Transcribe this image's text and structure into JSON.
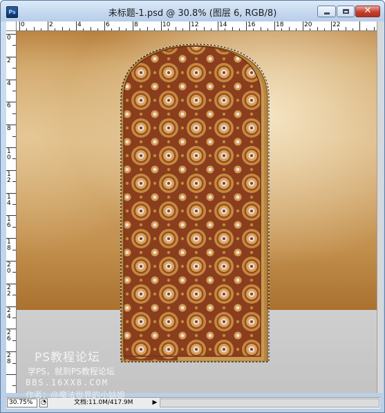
{
  "window": {
    "title": "未标题-1.psd @ 30.8% (图层 6, RGB/8)",
    "app_icon_label": "Ps",
    "close_glyph": "✕"
  },
  "ruler_h_labels": [
    "0",
    "2",
    "4",
    "6",
    "8",
    "10",
    "12",
    "14",
    "16",
    "18",
    "20",
    "22"
  ],
  "ruler_v_labels": [
    "0",
    "2",
    "4",
    "6",
    "8",
    "1\n0",
    "1\n2",
    "1\n4",
    "1\n6",
    "1\n8",
    "2\n0",
    "2\n2",
    "2\n4",
    "2\n6",
    "2\n8"
  ],
  "status": {
    "zoom": "30.75%",
    "info_glyph": "◔",
    "doc_size": "文档:11.0M/417.9M",
    "menu_arrow": "▶"
  },
  "watermark": {
    "title": "PS教程论坛",
    "subtitle": "学PS，就到PS教程论坛",
    "url": "BBS.16XX8.COM",
    "author": "作者：@魔法世界的小姑娘"
  },
  "colors": {
    "pattern_bg": "#8a3e1e",
    "pattern_medallion": "#c58a3e",
    "pattern_flower": "#e9dcd8",
    "frame_gold": "#b8863f",
    "floor": "#c9c9c9"
  },
  "icons": {
    "app": "photoshop-app-icon",
    "minimize": "minimize-icon",
    "maximize": "maximize-icon",
    "close": "close-icon",
    "info": "document-info-icon",
    "menu": "status-menu-arrow-icon"
  }
}
